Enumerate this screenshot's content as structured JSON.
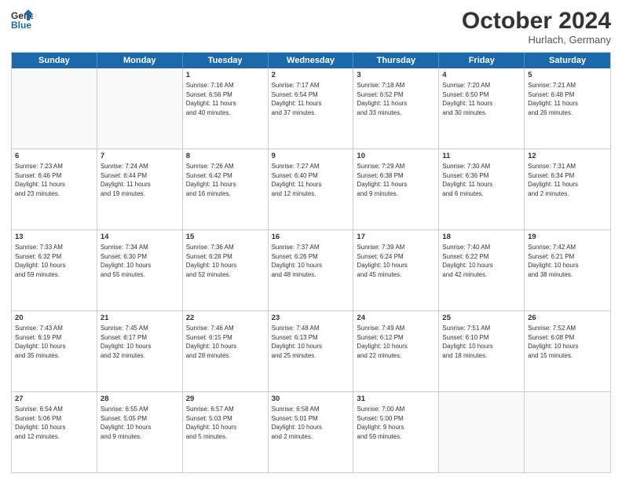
{
  "header": {
    "logo_general": "General",
    "logo_blue": "Blue",
    "month_title": "October 2024",
    "location": "Hurlach, Germany"
  },
  "days_of_week": [
    "Sunday",
    "Monday",
    "Tuesday",
    "Wednesday",
    "Thursday",
    "Friday",
    "Saturday"
  ],
  "rows": [
    [
      {
        "day": "",
        "lines": []
      },
      {
        "day": "",
        "lines": []
      },
      {
        "day": "1",
        "lines": [
          "Sunrise: 7:16 AM",
          "Sunset: 6:56 PM",
          "Daylight: 11 hours",
          "and 40 minutes."
        ]
      },
      {
        "day": "2",
        "lines": [
          "Sunrise: 7:17 AM",
          "Sunset: 6:54 PM",
          "Daylight: 11 hours",
          "and 37 minutes."
        ]
      },
      {
        "day": "3",
        "lines": [
          "Sunrise: 7:18 AM",
          "Sunset: 6:52 PM",
          "Daylight: 11 hours",
          "and 33 minutes."
        ]
      },
      {
        "day": "4",
        "lines": [
          "Sunrise: 7:20 AM",
          "Sunset: 6:50 PM",
          "Daylight: 11 hours",
          "and 30 minutes."
        ]
      },
      {
        "day": "5",
        "lines": [
          "Sunrise: 7:21 AM",
          "Sunset: 6:48 PM",
          "Daylight: 11 hours",
          "and 26 minutes."
        ]
      }
    ],
    [
      {
        "day": "6",
        "lines": [
          "Sunrise: 7:23 AM",
          "Sunset: 6:46 PM",
          "Daylight: 11 hours",
          "and 23 minutes."
        ]
      },
      {
        "day": "7",
        "lines": [
          "Sunrise: 7:24 AM",
          "Sunset: 6:44 PM",
          "Daylight: 11 hours",
          "and 19 minutes."
        ]
      },
      {
        "day": "8",
        "lines": [
          "Sunrise: 7:26 AM",
          "Sunset: 6:42 PM",
          "Daylight: 11 hours",
          "and 16 minutes."
        ]
      },
      {
        "day": "9",
        "lines": [
          "Sunrise: 7:27 AM",
          "Sunset: 6:40 PM",
          "Daylight: 11 hours",
          "and 12 minutes."
        ]
      },
      {
        "day": "10",
        "lines": [
          "Sunrise: 7:29 AM",
          "Sunset: 6:38 PM",
          "Daylight: 11 hours",
          "and 9 minutes."
        ]
      },
      {
        "day": "11",
        "lines": [
          "Sunrise: 7:30 AM",
          "Sunset: 6:36 PM",
          "Daylight: 11 hours",
          "and 6 minutes."
        ]
      },
      {
        "day": "12",
        "lines": [
          "Sunrise: 7:31 AM",
          "Sunset: 6:34 PM",
          "Daylight: 11 hours",
          "and 2 minutes."
        ]
      }
    ],
    [
      {
        "day": "13",
        "lines": [
          "Sunrise: 7:33 AM",
          "Sunset: 6:32 PM",
          "Daylight: 10 hours",
          "and 59 minutes."
        ]
      },
      {
        "day": "14",
        "lines": [
          "Sunrise: 7:34 AM",
          "Sunset: 6:30 PM",
          "Daylight: 10 hours",
          "and 55 minutes."
        ]
      },
      {
        "day": "15",
        "lines": [
          "Sunrise: 7:36 AM",
          "Sunset: 6:28 PM",
          "Daylight: 10 hours",
          "and 52 minutes."
        ]
      },
      {
        "day": "16",
        "lines": [
          "Sunrise: 7:37 AM",
          "Sunset: 6:26 PM",
          "Daylight: 10 hours",
          "and 48 minutes."
        ]
      },
      {
        "day": "17",
        "lines": [
          "Sunrise: 7:39 AM",
          "Sunset: 6:24 PM",
          "Daylight: 10 hours",
          "and 45 minutes."
        ]
      },
      {
        "day": "18",
        "lines": [
          "Sunrise: 7:40 AM",
          "Sunset: 6:22 PM",
          "Daylight: 10 hours",
          "and 42 minutes."
        ]
      },
      {
        "day": "19",
        "lines": [
          "Sunrise: 7:42 AM",
          "Sunset: 6:21 PM",
          "Daylight: 10 hours",
          "and 38 minutes."
        ]
      }
    ],
    [
      {
        "day": "20",
        "lines": [
          "Sunrise: 7:43 AM",
          "Sunset: 6:19 PM",
          "Daylight: 10 hours",
          "and 35 minutes."
        ]
      },
      {
        "day": "21",
        "lines": [
          "Sunrise: 7:45 AM",
          "Sunset: 6:17 PM",
          "Daylight: 10 hours",
          "and 32 minutes."
        ]
      },
      {
        "day": "22",
        "lines": [
          "Sunrise: 7:46 AM",
          "Sunset: 6:15 PM",
          "Daylight: 10 hours",
          "and 28 minutes."
        ]
      },
      {
        "day": "23",
        "lines": [
          "Sunrise: 7:48 AM",
          "Sunset: 6:13 PM",
          "Daylight: 10 hours",
          "and 25 minutes."
        ]
      },
      {
        "day": "24",
        "lines": [
          "Sunrise: 7:49 AM",
          "Sunset: 6:12 PM",
          "Daylight: 10 hours",
          "and 22 minutes."
        ]
      },
      {
        "day": "25",
        "lines": [
          "Sunrise: 7:51 AM",
          "Sunset: 6:10 PM",
          "Daylight: 10 hours",
          "and 18 minutes."
        ]
      },
      {
        "day": "26",
        "lines": [
          "Sunrise: 7:52 AM",
          "Sunset: 6:08 PM",
          "Daylight: 10 hours",
          "and 15 minutes."
        ]
      }
    ],
    [
      {
        "day": "27",
        "lines": [
          "Sunrise: 6:54 AM",
          "Sunset: 5:06 PM",
          "Daylight: 10 hours",
          "and 12 minutes."
        ]
      },
      {
        "day": "28",
        "lines": [
          "Sunrise: 6:55 AM",
          "Sunset: 5:05 PM",
          "Daylight: 10 hours",
          "and 9 minutes."
        ]
      },
      {
        "day": "29",
        "lines": [
          "Sunrise: 6:57 AM",
          "Sunset: 5:03 PM",
          "Daylight: 10 hours",
          "and 5 minutes."
        ]
      },
      {
        "day": "30",
        "lines": [
          "Sunrise: 6:58 AM",
          "Sunset: 5:01 PM",
          "Daylight: 10 hours",
          "and 2 minutes."
        ]
      },
      {
        "day": "31",
        "lines": [
          "Sunrise: 7:00 AM",
          "Sunset: 5:00 PM",
          "Daylight: 9 hours",
          "and 59 minutes."
        ]
      },
      {
        "day": "",
        "lines": []
      },
      {
        "day": "",
        "lines": []
      }
    ]
  ]
}
